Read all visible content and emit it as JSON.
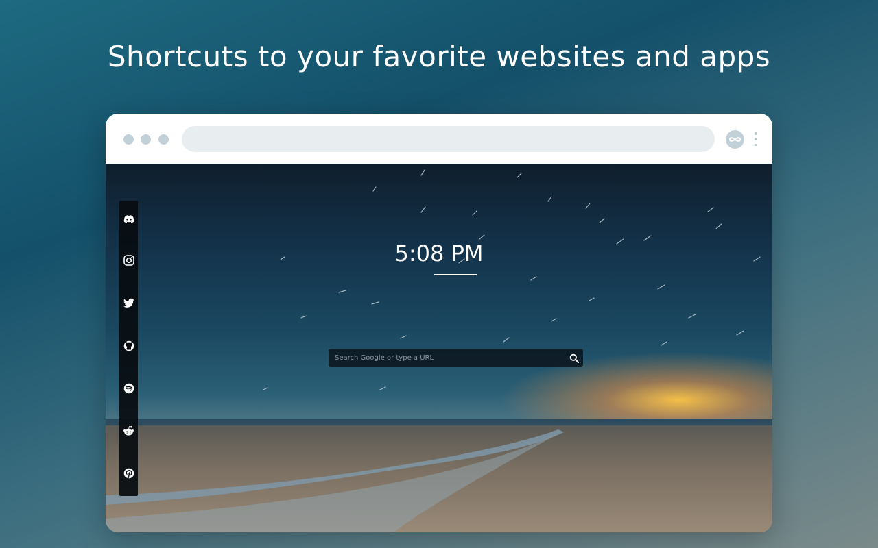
{
  "headline": "Shortcuts to your favorite websites and apps",
  "browser": {
    "extension_icon": "infinity-logo-icon",
    "menu_icon": "kebab-menu-icon"
  },
  "newtab": {
    "clock": "5:08 PM",
    "search": {
      "placeholder": "Search Google or type a URL",
      "button_icon": "search-icon"
    },
    "shortcuts": [
      {
        "name": "Discord",
        "icon": "discord-icon"
      },
      {
        "name": "Instagram",
        "icon": "instagram-icon"
      },
      {
        "name": "Twitter",
        "icon": "twitter-icon"
      },
      {
        "name": "GitHub",
        "icon": "github-icon"
      },
      {
        "name": "Spotify",
        "icon": "spotify-icon"
      },
      {
        "name": "Reddit",
        "icon": "reddit-icon"
      },
      {
        "name": "Pinterest",
        "icon": "pinterest-icon"
      }
    ]
  },
  "colors": {
    "page_background": "#1e6a80",
    "browser_frame": "#ffffff",
    "address_bar": "#e8eef0",
    "window_dots": "#c2d0d8",
    "sidebar": "#080c10",
    "sunset_glow": "#ffc446"
  }
}
